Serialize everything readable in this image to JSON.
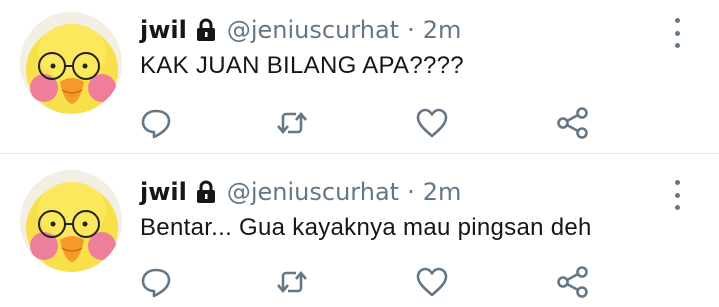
{
  "tweets": [
    {
      "name": "jwil",
      "handle": "@jeniuscurhat",
      "separator": "·",
      "time": "2m",
      "text": "KAK JUAN BILANG APA????"
    },
    {
      "name": "jwil",
      "handle": "@jeniuscurhat",
      "separator": "·",
      "time": "2m",
      "text": "Bentar... Gua kayaknya mau pingsan deh"
    }
  ],
  "colors": {
    "text_primary": "#14171a",
    "text_secondary": "#657786",
    "divider": "#e1e8ed",
    "icon": "#657786"
  },
  "icons": [
    "lock-icon",
    "more-vertical-icon",
    "reply-icon",
    "retweet-icon",
    "like-icon",
    "share-icon"
  ]
}
